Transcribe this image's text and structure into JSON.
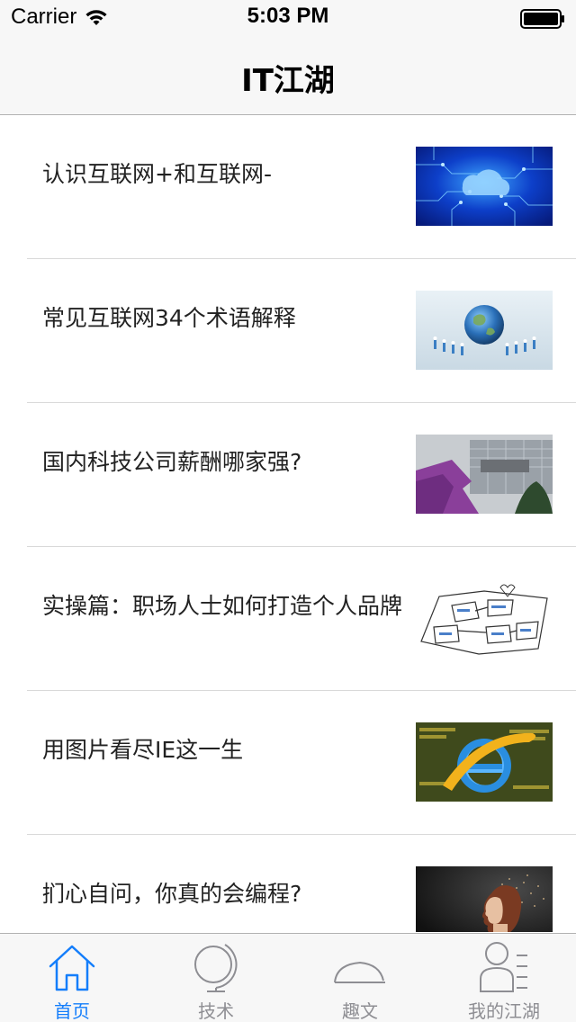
{
  "status_bar": {
    "carrier": "Carrier",
    "time": "5:03 PM",
    "wifi_icon": "wifi-icon",
    "battery_icon": "battery-icon"
  },
  "nav": {
    "title": "IT江湖"
  },
  "news": [
    {
      "title": "认识互联网+和互联网-",
      "thumbnail": "circuit-cloud-image"
    },
    {
      "title": "常见互联网34个术语解释",
      "thumbnail": "globe-network-image"
    },
    {
      "title": "国内科技公司薪酬哪家强?",
      "thumbnail": "yahoo-building-image"
    },
    {
      "title": "实操篇：职场人士如何打造个人品牌",
      "thumbnail": "sketch-diagram-image"
    },
    {
      "title": "用图片看尽IE这一生",
      "thumbnail": "ie-logo-image"
    },
    {
      "title": "扪心自问，你真的会编程?",
      "thumbnail": "woman-profile-image"
    }
  ],
  "tabbar": {
    "active_color": "#147efb",
    "inactive_color": "#8e8e93",
    "tabs": [
      {
        "label": "首页",
        "icon": "home-icon",
        "active": true
      },
      {
        "label": "技术",
        "icon": "globe-icon",
        "active": false
      },
      {
        "label": "趣文",
        "icon": "hat-icon",
        "active": false
      },
      {
        "label": "我的江湖",
        "icon": "user-list-icon",
        "active": false
      }
    ]
  }
}
